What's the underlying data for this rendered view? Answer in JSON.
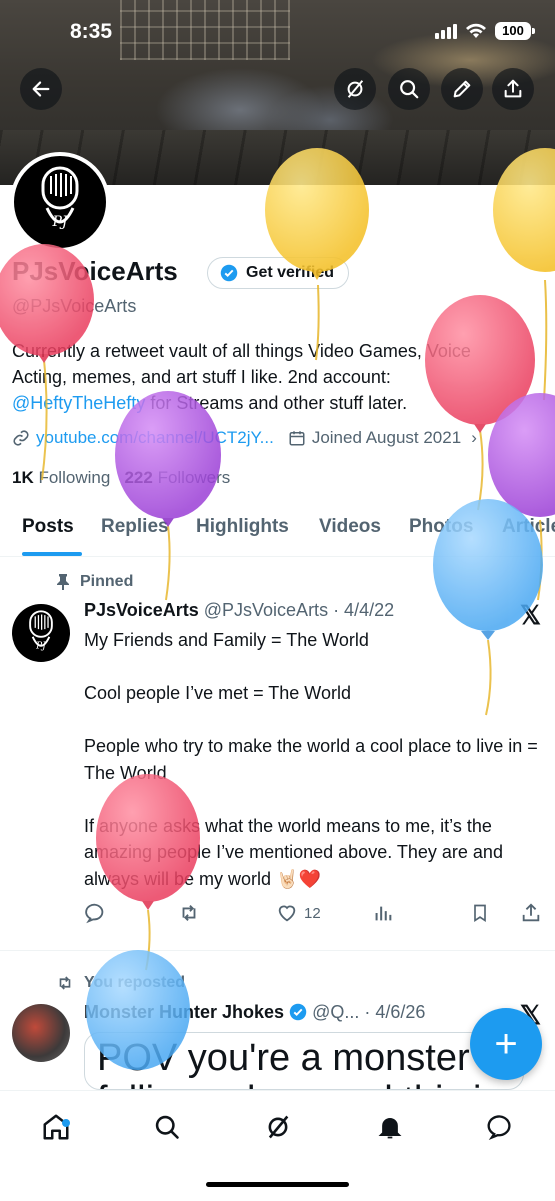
{
  "status_bar": {
    "time": "8:35",
    "battery": "100"
  },
  "profile": {
    "name": "PJsVoiceArts",
    "verify_label": "Get verified",
    "handle": "@PJsVoiceArts",
    "bio_line1": "Currently a retweet vault of all things Video Games, Voice",
    "bio_line2": "Acting, memes, and art stuff I like. 2nd account:",
    "bio_mention": "@HeftyTheHefty",
    "bio_line3_rest": " for Streams and other stuff later.",
    "website": "youtube.com/channel/UCT2jY...",
    "joined": "Joined August 2021",
    "following_count": "1K",
    "following_label": "Following",
    "followers_count": "222",
    "followers_label": "Followers",
    "avatar_text": "PJ"
  },
  "tabs": [
    "Posts",
    "Replies",
    "Highlights",
    "Videos",
    "Photos",
    "Articles"
  ],
  "pinned_post": {
    "pinned_label": "Pinned",
    "author": "PJsVoiceArts",
    "handle_date": "@PJsVoiceArts · 4/4/22",
    "text": "My Friends and Family = The World\n\nCool people I’ve met = The World\n\nPeople who try to make the world a cool place to live in = The World\n\nIf anyone asks what the world means to me, it’s the amazing people I’ve mentioned above. They are and always will be my world 🤘🏻❤️",
    "likes": "12"
  },
  "repost": {
    "label": "You reposted",
    "author": "Monster Hunter Jhokes",
    "handle_date": "@Q... · 4/6/26",
    "embed_line1": "POV you're a monster",
    "embed_line2": "falling asleep and this is"
  },
  "fab_label": "+",
  "colors": {
    "accent": "#1d9bf0",
    "text": "#0f1419",
    "muted": "#536471"
  }
}
